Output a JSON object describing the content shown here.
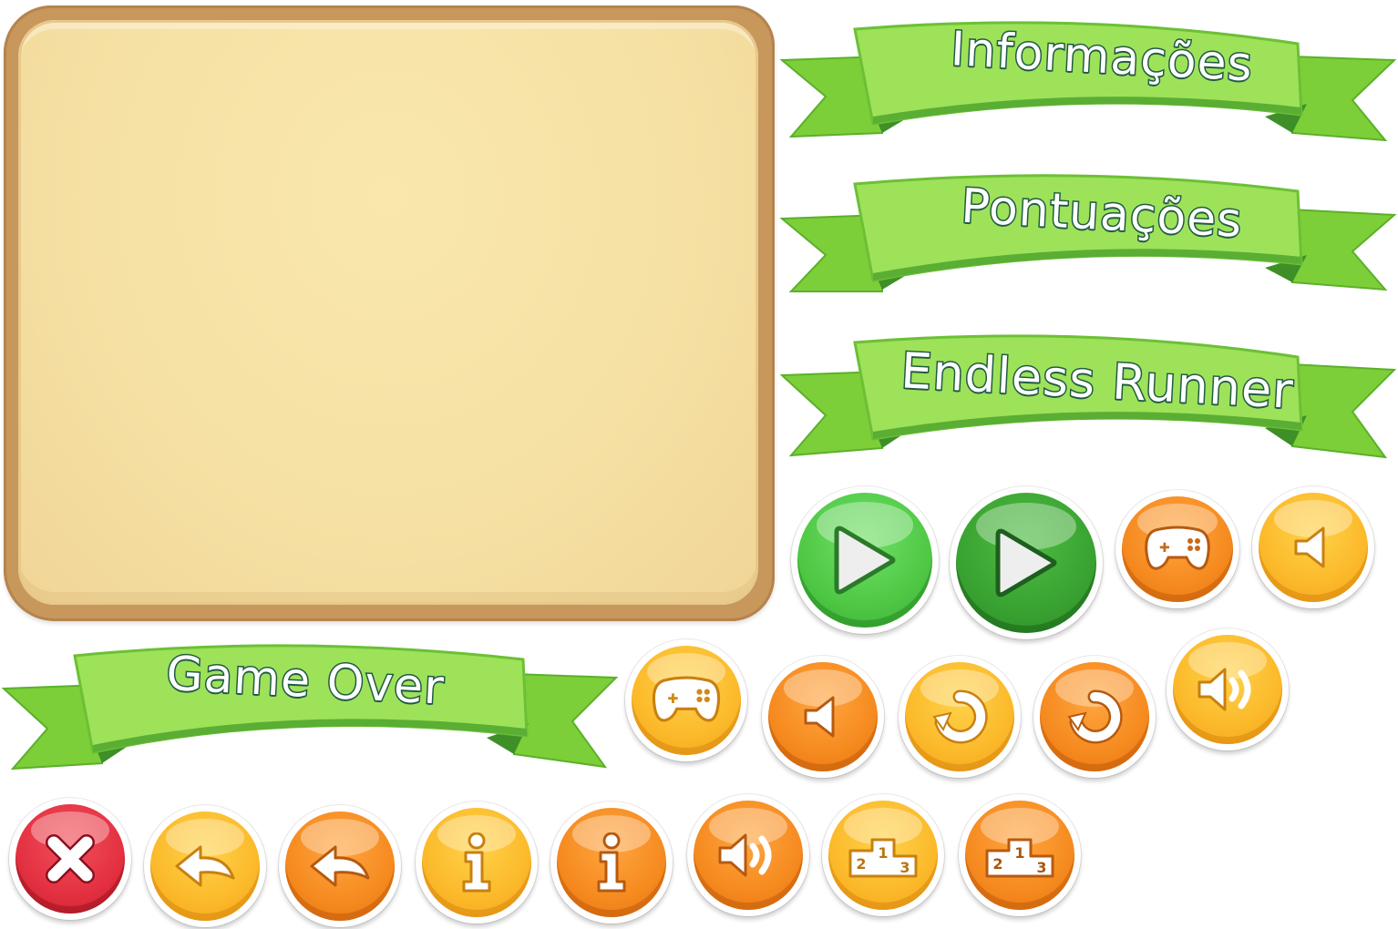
{
  "panel": {
    "label": "parchment-panel"
  },
  "banners": {
    "info": "Informações",
    "scores": "Pontuações",
    "title": "Endless Runner",
    "gameover": "Game Over"
  },
  "buttons": {
    "play_light": "play-icon",
    "play_dark": "play-icon",
    "gamepad": "gamepad-icon",
    "sound_off": "speaker-icon",
    "restart": "restart-icon",
    "sound_on": "sound-on-icon",
    "close": "close-icon",
    "back": "back-arrow-icon",
    "info": "info-icon",
    "leaderboard": "podium-icon",
    "podium_digits": [
      "2",
      "1",
      "3"
    ]
  },
  "colors": {
    "ribbon_green": "#8fdc45",
    "ribbon_dark": "#4aa82f",
    "text_outline": "#1f5a44",
    "button_yellow": "#fbb92a",
    "button_orange": "#f58a1f",
    "button_green": "#4fc845",
    "button_red": "#e33040"
  }
}
